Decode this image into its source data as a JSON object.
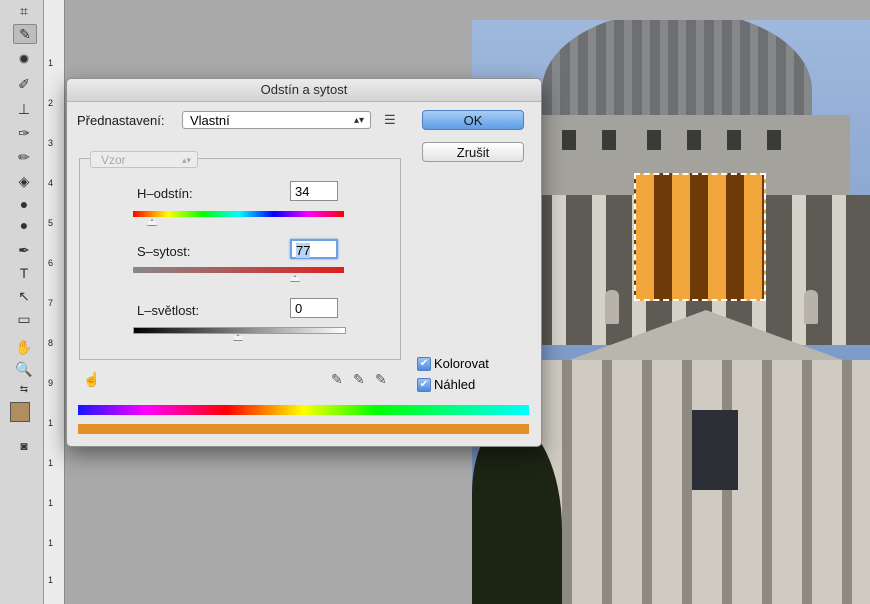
{
  "ruler": {
    "labels": [
      "1",
      "2",
      "3",
      "4",
      "5",
      "6",
      "7",
      "8",
      "9",
      "1",
      "1",
      "1",
      "1",
      "1"
    ]
  },
  "tools": {
    "icons": [
      "crop-icon",
      "eyedropper-icon",
      "spot-heal-icon",
      "brush-icon",
      "stamp-icon",
      "history-brush-icon",
      "eraser-icon",
      "bucket-icon",
      "blur-icon",
      "dodge-icon",
      "pen-icon",
      "type-icon",
      "path-select-icon",
      "rectangle-icon",
      "hand-icon",
      "zoom-icon"
    ],
    "foreground_color": "#b08e60",
    "background_color": "#ffffff"
  },
  "dialog": {
    "title": "Odstín a sytost",
    "preset_label": "Přednastavení:",
    "preset_value": "Vlastní",
    "ok_label": "OK",
    "cancel_label": "Zrušit",
    "channel_value": "Vzor",
    "hue": {
      "label": "H–odstín:",
      "value": "34"
    },
    "saturation": {
      "label": "S–sytost:",
      "value": "77"
    },
    "lightness": {
      "label": "L–světlost:",
      "value": "0"
    },
    "colorize": {
      "label": "Kolorovat",
      "checked": true
    },
    "preview": {
      "label": "Náhled",
      "checked": true
    },
    "result_color": "#e3902a"
  }
}
